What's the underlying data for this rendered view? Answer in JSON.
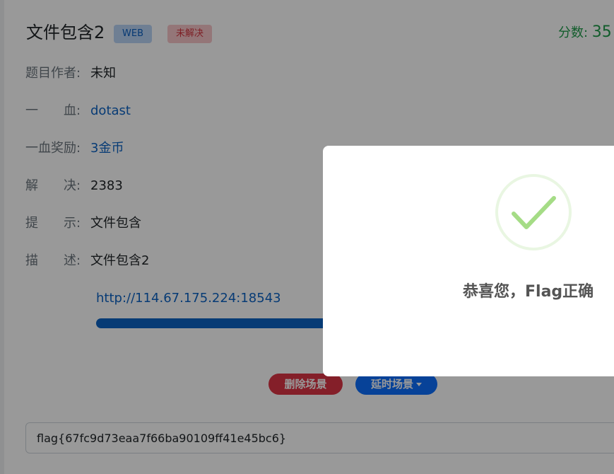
{
  "challenge": {
    "title": "文件包含2",
    "category_badge": "WEB",
    "status_badge": "未解决",
    "score_label": "分数: ",
    "score_value": "35"
  },
  "info": {
    "author_label": "题目作者:",
    "author_value": "未知",
    "first_blood_label": "一　　血:",
    "first_blood_value": "dotast",
    "reward_label": "一血奖励:",
    "reward_value": "3金币",
    "solved_label": "解　　决:",
    "solved_value": "2383",
    "hint_label": "提　　示:",
    "hint_value": "文件包含",
    "desc_label": "描　　述:",
    "desc_value": "文件包含2"
  },
  "scene": {
    "url": "http://114.67.175.224:18543",
    "delete_label": "删除场景",
    "delay_label": "延时场景"
  },
  "flag_input": {
    "value": "flag{67fc9d73eaa7f66ba90109ff41e45bc6}"
  },
  "modal": {
    "message": "恭喜您，Flag正确",
    "icon": "success-check-icon",
    "icon_color": "#a5dc86"
  },
  "colors": {
    "primary": "#0d6efd",
    "danger": "#dc3545",
    "success": "#1e9b4a",
    "link": "#0d63c4"
  }
}
